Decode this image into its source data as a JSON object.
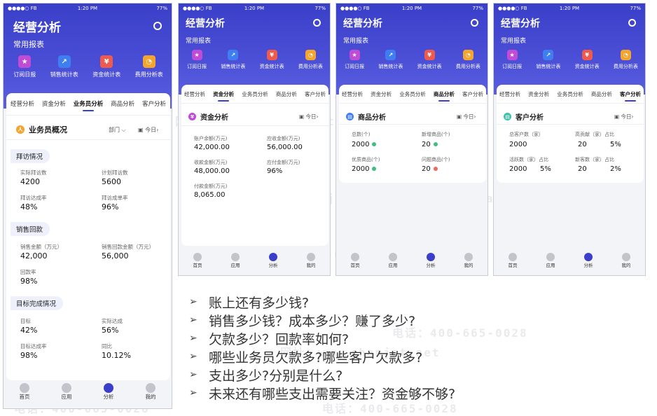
{
  "status": {
    "carrier": "●●●●○ FB ",
    "time": "1:20 PM",
    "battery": "77%"
  },
  "app_title": "经营分析",
  "common_reports": "常用报表",
  "shortcuts": [
    {
      "label": "订阅日报",
      "color": "#c04cd6",
      "glyph": "★"
    },
    {
      "label": "销售统计表",
      "color": "#3f7ef0",
      "glyph": "↗"
    },
    {
      "label": "资金统计表",
      "color": "#ef5a4f",
      "glyph": "¥"
    },
    {
      "label": "费用分析表",
      "color": "#f3a52d",
      "glyph": "◔"
    }
  ],
  "tabs": [
    "经营分析",
    "资金分析",
    "业务员分析",
    "商品分析",
    "客户分析"
  ],
  "today": "今日",
  "phone1": {
    "title": "业务员概况",
    "dept": "部门",
    "sections": [
      {
        "name": "拜访情况",
        "items": [
          {
            "label": "实际拜访数",
            "value": "4200"
          },
          {
            "label": "计划拜访数",
            "value": "5600"
          },
          {
            "label": "拜访达成率",
            "value": "48%"
          },
          {
            "label": "拜访成单率",
            "value": "96%"
          }
        ]
      },
      {
        "name": "销售回款",
        "items": [
          {
            "label": "销售金额（万元）",
            "value": "42,000"
          },
          {
            "label": "销售回款金额（万元）",
            "value": "56,000"
          },
          {
            "label": "回款率",
            "value": "98%"
          }
        ]
      },
      {
        "name": "目标完成情况",
        "items": [
          {
            "label": "目标",
            "value": "42%"
          },
          {
            "label": "实际达成",
            "value": "56%"
          },
          {
            "label": "目标达成率",
            "value": "98%"
          },
          {
            "label": "同比",
            "value": "10.12%"
          }
        ]
      }
    ]
  },
  "phone2": {
    "title": "资金分析",
    "items": [
      {
        "label": "账户余额(万元)",
        "value": "42,000.00"
      },
      {
        "label": "应收金额(万元)",
        "value": "56,000.00"
      },
      {
        "label": "收款金额(万元)",
        "value": "48,000.00"
      },
      {
        "label": "应付金额(万元)",
        "value": "96%"
      },
      {
        "label": "付款金额(万元)",
        "value": "8,065.00"
      }
    ]
  },
  "phone3": {
    "title": "商品分析",
    "items": [
      {
        "label": "总数(个)",
        "value": "2000",
        "dot": "#3dbf7f"
      },
      {
        "label": "新增商品(个)",
        "value": "20",
        "dot": "#3dbf7f"
      },
      {
        "label": "优质商品(个)",
        "value": "2000",
        "dot": "#3dbf7f"
      },
      {
        "label": "问题商品(个)",
        "value": "20",
        "dot": "#ef6a5a"
      }
    ]
  },
  "phone4": {
    "title": "客户分析",
    "items": [
      {
        "label": "总客户数（家）",
        "value": "2000"
      },
      {
        "label": "高贡献（家）占比",
        "value": "20",
        "value2": "5%"
      },
      {
        "label": "活跃数（家）占比",
        "value": "2000",
        "value2": "5%"
      },
      {
        "label": "新客数（家）占比",
        "value": "20",
        "value2": "2%"
      }
    ]
  },
  "bottom_nav": [
    {
      "label": "首页"
    },
    {
      "label": "应用"
    },
    {
      "label": "分析",
      "active": true
    },
    {
      "label": "我的"
    }
  ],
  "questions": [
    "账上还有多少钱?",
    "销售多少钱？成本多少？赚了多少?",
    "欠款多少？回款率如何?",
    "哪些业务员欠款多?哪些客户欠款多?",
    "支出多少?分别是什么?",
    "未来还有哪些支出需要关注？资金够不够?"
  ],
  "bullet_mark": "➢",
  "watermarks": {
    "phone": "电话：400-665-0028",
    "site": "网址：www.chanjet.net"
  }
}
